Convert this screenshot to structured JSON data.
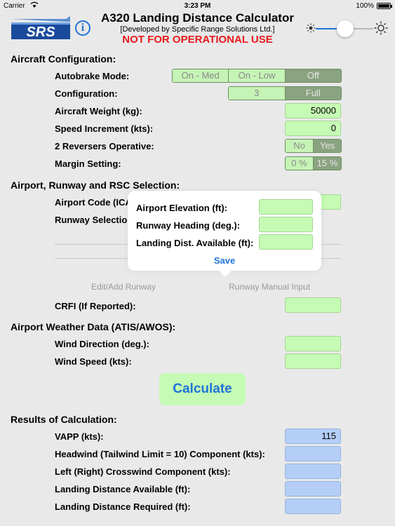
{
  "status_bar": {
    "carrier": "Carrier",
    "time": "3:23 PM",
    "battery": "100%"
  },
  "header": {
    "logo_text": "SRS",
    "title": "A320 Landing Distance Calculator",
    "subtitle": "[Developed by Specific Range Solutions Ltd.]",
    "warning": "NOT FOR OPERATIONAL USE",
    "brightness_level": 0.5
  },
  "aircraft_config": {
    "heading": "Aircraft Configuration:",
    "autobrake_label": "Autobrake Mode:",
    "autobrake_options": [
      "On - Med",
      "On - Low",
      "Off"
    ],
    "autobrake_selected": "Off",
    "configuration_label": "Configuration:",
    "configuration_options": [
      "3",
      "Full"
    ],
    "configuration_selected": "Full",
    "weight_label": "Aircraft Weight (kg):",
    "weight_value": "50000",
    "speed_inc_label": "Speed Increment (kts):",
    "speed_inc_value": "0",
    "reversers_label": "2 Reversers Operative:",
    "reversers_options": [
      "No",
      "Yes"
    ],
    "reversers_selected": "Yes",
    "margin_label": "Margin Setting:",
    "margin_options": [
      "0 %",
      "15 %"
    ],
    "margin_selected": "15 %"
  },
  "airport": {
    "heading": "Airport, Runway and RSC Selection:",
    "airport_code_label": "Airport Code (ICA",
    "runway_selection_label": "Runway Selection",
    "edit_runway_link": "Edit/Add Runway",
    "manual_input_link": "Runway Manual Input",
    "crfi_label": "CRFI (If Reported):",
    "crfi_value": ""
  },
  "popover": {
    "elevation_label": "Airport Elevation (ft):",
    "heading_label": "Runway Heading (deg.):",
    "lda_label": "Landing Dist. Available (ft):",
    "save_label": "Save"
  },
  "weather": {
    "heading": "Airport Weather Data (ATIS/AWOS):",
    "wind_dir_label": "Wind Direction (deg.):",
    "wind_dir_value": "",
    "wind_speed_label": "Wind Speed (kts):",
    "wind_speed_value": ""
  },
  "calculate_label": "Calculate",
  "results": {
    "heading": "Results of Calculation:",
    "vapp_label": "VAPP (kts):",
    "vapp_value": "115",
    "headwind_label": "Headwind (Tailwind Limit = 10) Component (kts):",
    "headwind_value": "",
    "crosswind_label": "Left (Right) Crosswind Component (kts):",
    "crosswind_value": "",
    "lda_label": "Landing Distance Available (ft):",
    "lda_value": "",
    "ldr_label": "Landing Distance Required (ft):",
    "ldr_value": ""
  },
  "colors": {
    "background": "#e9e9e9",
    "field_green": "#c5fbb4",
    "field_blue": "#b4cef7",
    "segment_selected": "#8aa381",
    "accent_blue": "#1f74d8",
    "warning_red": "#e8191b"
  }
}
